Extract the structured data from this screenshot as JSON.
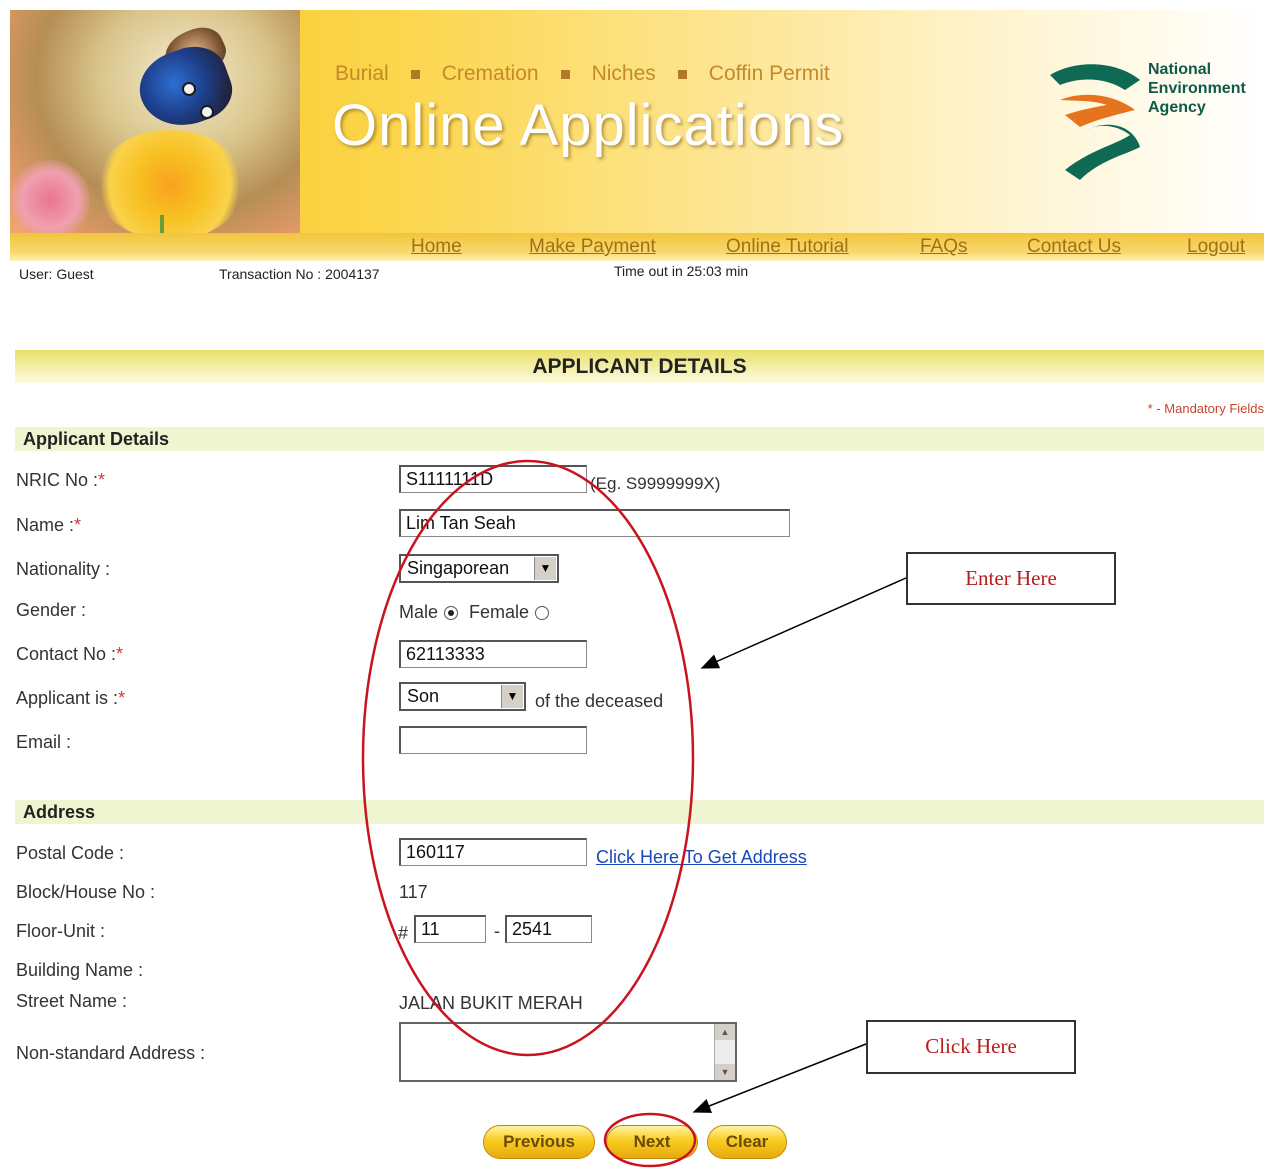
{
  "header": {
    "categories": [
      "Burial",
      "Cremation",
      "Niches",
      "Coffin Permit"
    ],
    "app_title": "Online Applications",
    "agency_logo_lines": [
      "National",
      "Environment",
      "Agency"
    ]
  },
  "nav": {
    "items": [
      "Home",
      "Make Payment",
      "Online Tutorial",
      "FAQs",
      "Contact Us",
      "Logout"
    ]
  },
  "status": {
    "user": "User: Guest",
    "transaction": "Transaction No : 2004137",
    "timeout": "Time out in 25:03 min"
  },
  "page": {
    "title": "APPLICANT DETAILS",
    "mandatory_note": "* - Mandatory Fields"
  },
  "applicant_section": {
    "heading": "Applicant Details",
    "nric_label": "NRIC No :",
    "nric_value": "S1111111D",
    "nric_hint": "(Eg. S9999999X)",
    "name_label": "Name :",
    "name_value": "Lim Tan Seah",
    "nationality_label": "Nationality :",
    "nationality_value": "Singaporean",
    "gender_label": "Gender :",
    "gender_male": "Male",
    "gender_female": "Female",
    "gender_selected": "Male",
    "contact_label": "Contact No :",
    "contact_value": "62113333",
    "relation_label": "Applicant is :",
    "relation_value": "Son",
    "relation_suffix": "of the deceased",
    "email_label": "Email :",
    "email_value": ""
  },
  "address_section": {
    "heading": "Address",
    "postal_label": "Postal Code :",
    "postal_value": "160117",
    "get_address_link": "Click Here To Get Address",
    "block_label": "Block/House No :",
    "block_value": "117",
    "floor_unit_label": "Floor-Unit :",
    "floor_prefix": "#",
    "floor_value": "11",
    "unit_separator": "-",
    "unit_value": "2541",
    "building_label": "Building Name :",
    "building_value": "",
    "street_label": "Street Name :",
    "street_value": "JALAN BUKIT MERAH",
    "nonstandard_label": "Non-standard Address :",
    "nonstandard_value": ""
  },
  "buttons": {
    "previous": "Previous",
    "next": "Next",
    "clear": "Clear"
  },
  "annotations": {
    "enter_here": "Enter Here",
    "click_here": "Click Here",
    "highlight_color": "#c8141e"
  },
  "colors": {
    "banner": "#f8cc3a",
    "nav_link": "#a07018",
    "required": "#d8343a",
    "link": "#1a48b8"
  }
}
